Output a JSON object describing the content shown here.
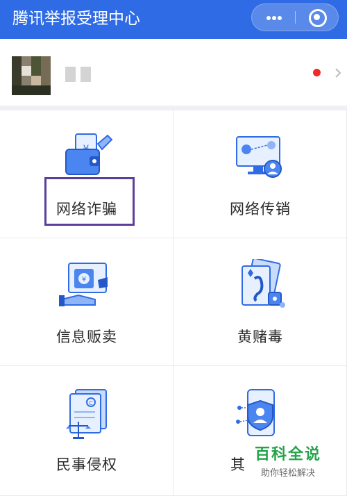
{
  "header": {
    "title": "腾讯举报受理中心",
    "background": "#2f6be4"
  },
  "profile": {
    "status_dot_color": "#ee2a2a"
  },
  "categories": [
    {
      "label": "网络诈骗",
      "icon": "wallet-icon"
    },
    {
      "label": "网络传销",
      "icon": "monitor-network-icon"
    },
    {
      "label": "信息贩卖",
      "icon": "money-exchange-icon"
    },
    {
      "label": "黄赌毒",
      "icon": "playing-cards-icon"
    },
    {
      "label": "民事侵权",
      "icon": "legal-document-icon"
    },
    {
      "label": "其",
      "icon": "phone-shield-icon"
    }
  ],
  "watermark": {
    "title": "百科全说",
    "subtitle": "助你轻松解决"
  },
  "colors": {
    "accent": "#2f6be4",
    "highlight_border": "#5b3f99",
    "watermark_green": "#24a44a"
  }
}
